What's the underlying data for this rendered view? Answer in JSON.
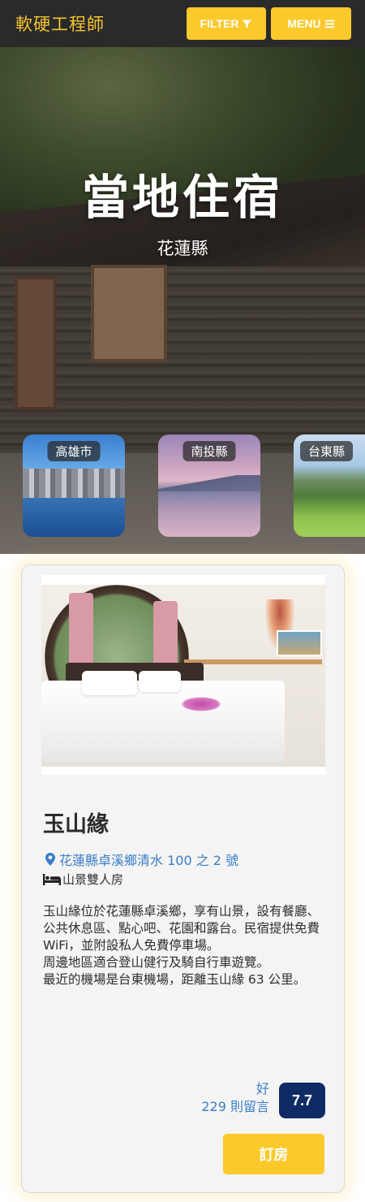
{
  "navbar": {
    "brand": "軟硬工程師",
    "filter_label": "FILTER",
    "menu_label": "MENU"
  },
  "hero": {
    "title": "當地住宿",
    "subtitle": "花蓮縣"
  },
  "regions": [
    {
      "label": "高雄市"
    },
    {
      "label": "南投縣"
    },
    {
      "label": "台東縣"
    }
  ],
  "listing": {
    "name": "玉山緣",
    "address": "花蓮縣卓溪鄉清水 100 之 2 號",
    "room_type": "山景雙人房",
    "description": [
      "玉山緣位於花蓮縣卓溪鄉，享有山景，設有餐廳、公共休息區、點心吧、花園和露台。民宿提供免費 WiFi，並附設私人免費停車場。",
      "周邊地區適合登山健行及騎自行車遊覽。",
      "最近的機場是台東機場，距離玉山緣 63 公里。"
    ],
    "rating_word": "好",
    "review_count": "229 則留言",
    "score": "7.7",
    "book_label": "訂房"
  },
  "colors": {
    "navbar_bg": "#2a2a2a",
    "brand": "#f4c430",
    "accent_yellow": "#fcc92c",
    "link_blue": "#3a7dc9",
    "score_navy": "#0f2b65"
  },
  "icons": {
    "filter": "filter-icon",
    "menu": "hamburger-icon",
    "location": "map-marker-icon",
    "bed": "bed-icon"
  }
}
